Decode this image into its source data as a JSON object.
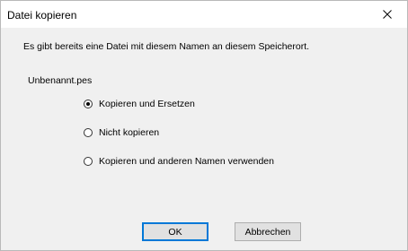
{
  "window": {
    "title": "Datei kopieren"
  },
  "dialog": {
    "message": "Es gibt bereits eine Datei mit diesem Namen an diesem Speicherort.",
    "filename": "Unbenannt.pes",
    "options": [
      {
        "label": "Kopieren und Ersetzen",
        "checked": true
      },
      {
        "label": "Nicht kopieren",
        "checked": false
      },
      {
        "label": "Kopieren und anderen Namen verwenden",
        "checked": false
      }
    ]
  },
  "buttons": {
    "ok_label": "OK",
    "cancel_label": "Abbrechen"
  },
  "icons": {
    "close": "close-icon"
  }
}
